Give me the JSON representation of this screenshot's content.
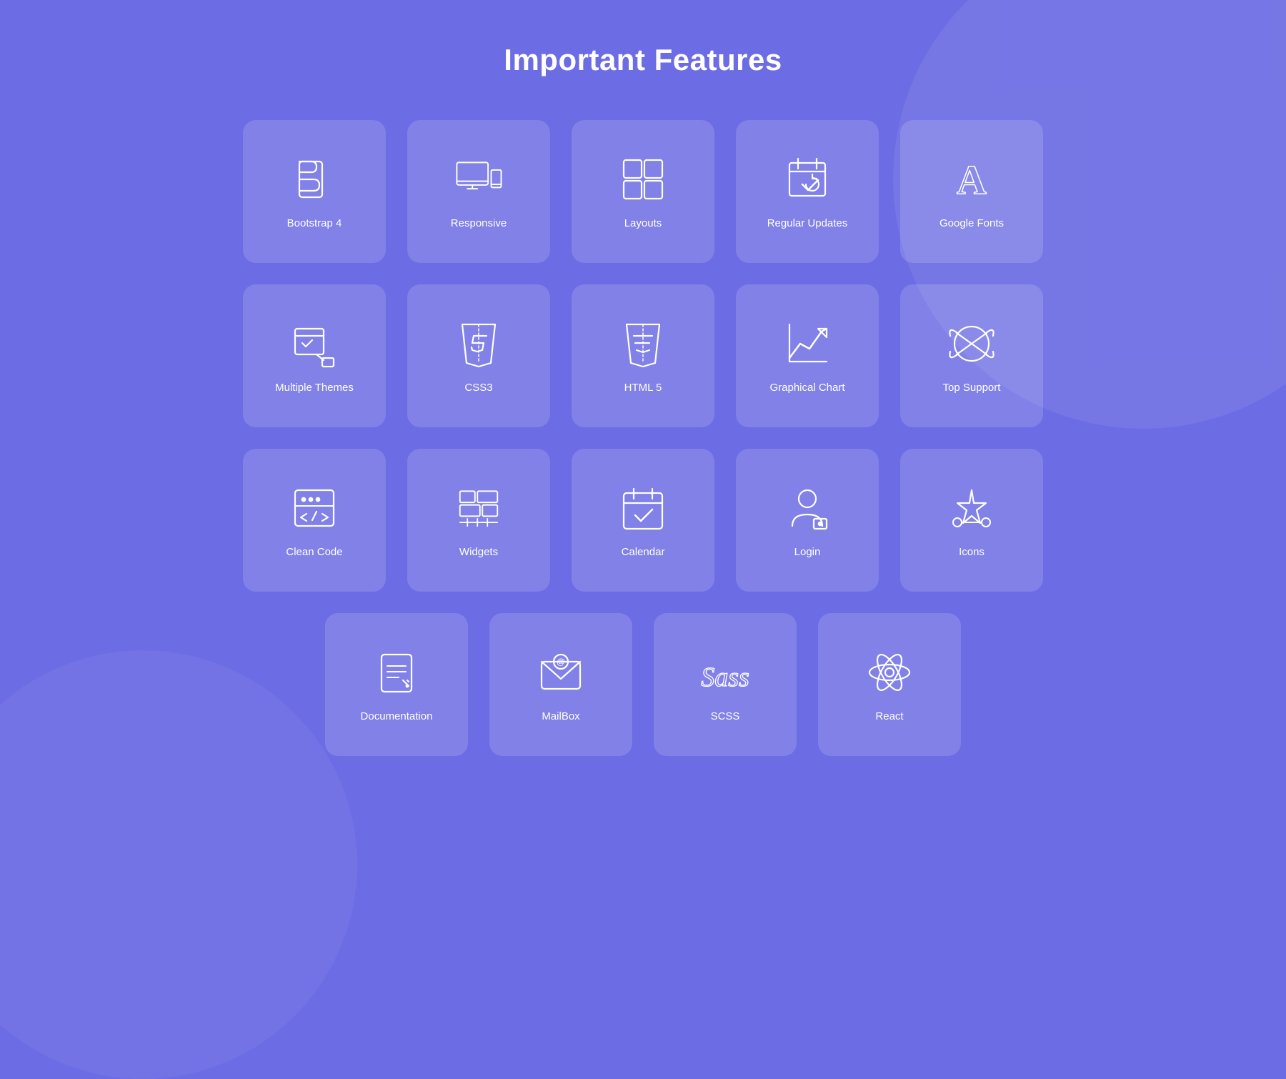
{
  "page": {
    "title": "Important Features"
  },
  "rows": [
    {
      "items": [
        {
          "id": "bootstrap",
          "label": "Bootstrap 4",
          "icon": "bootstrap"
        },
        {
          "id": "responsive",
          "label": "Responsive",
          "icon": "responsive"
        },
        {
          "id": "layouts",
          "label": "Layouts",
          "icon": "layouts"
        },
        {
          "id": "regular-updates",
          "label": "Regular Updates",
          "icon": "regular-updates"
        },
        {
          "id": "google-fonts",
          "label": "Google Fonts",
          "icon": "google-fonts"
        }
      ]
    },
    {
      "items": [
        {
          "id": "multiple-themes",
          "label": "Multiple Themes",
          "icon": "multiple-themes"
        },
        {
          "id": "css3",
          "label": "CSS3",
          "icon": "css3"
        },
        {
          "id": "html5",
          "label": "HTML 5",
          "icon": "html5"
        },
        {
          "id": "graphical-chart",
          "label": "Graphical Chart",
          "icon": "graphical-chart"
        },
        {
          "id": "top-support",
          "label": "Top Support",
          "icon": "top-support"
        }
      ]
    },
    {
      "items": [
        {
          "id": "clean-code",
          "label": "Clean Code",
          "icon": "clean-code"
        },
        {
          "id": "widgets",
          "label": "Widgets",
          "icon": "widgets"
        },
        {
          "id": "calendar",
          "label": "Calendar",
          "icon": "calendar"
        },
        {
          "id": "login",
          "label": "Login",
          "icon": "login"
        },
        {
          "id": "icons",
          "label": "Icons",
          "icon": "icons"
        }
      ]
    },
    {
      "items": [
        {
          "id": "documentation",
          "label": "Documentation",
          "icon": "documentation"
        },
        {
          "id": "mailbox",
          "label": "MailBox",
          "icon": "mailbox"
        },
        {
          "id": "scss",
          "label": "SCSS",
          "icon": "scss"
        },
        {
          "id": "react",
          "label": "React",
          "icon": "react"
        }
      ]
    }
  ]
}
